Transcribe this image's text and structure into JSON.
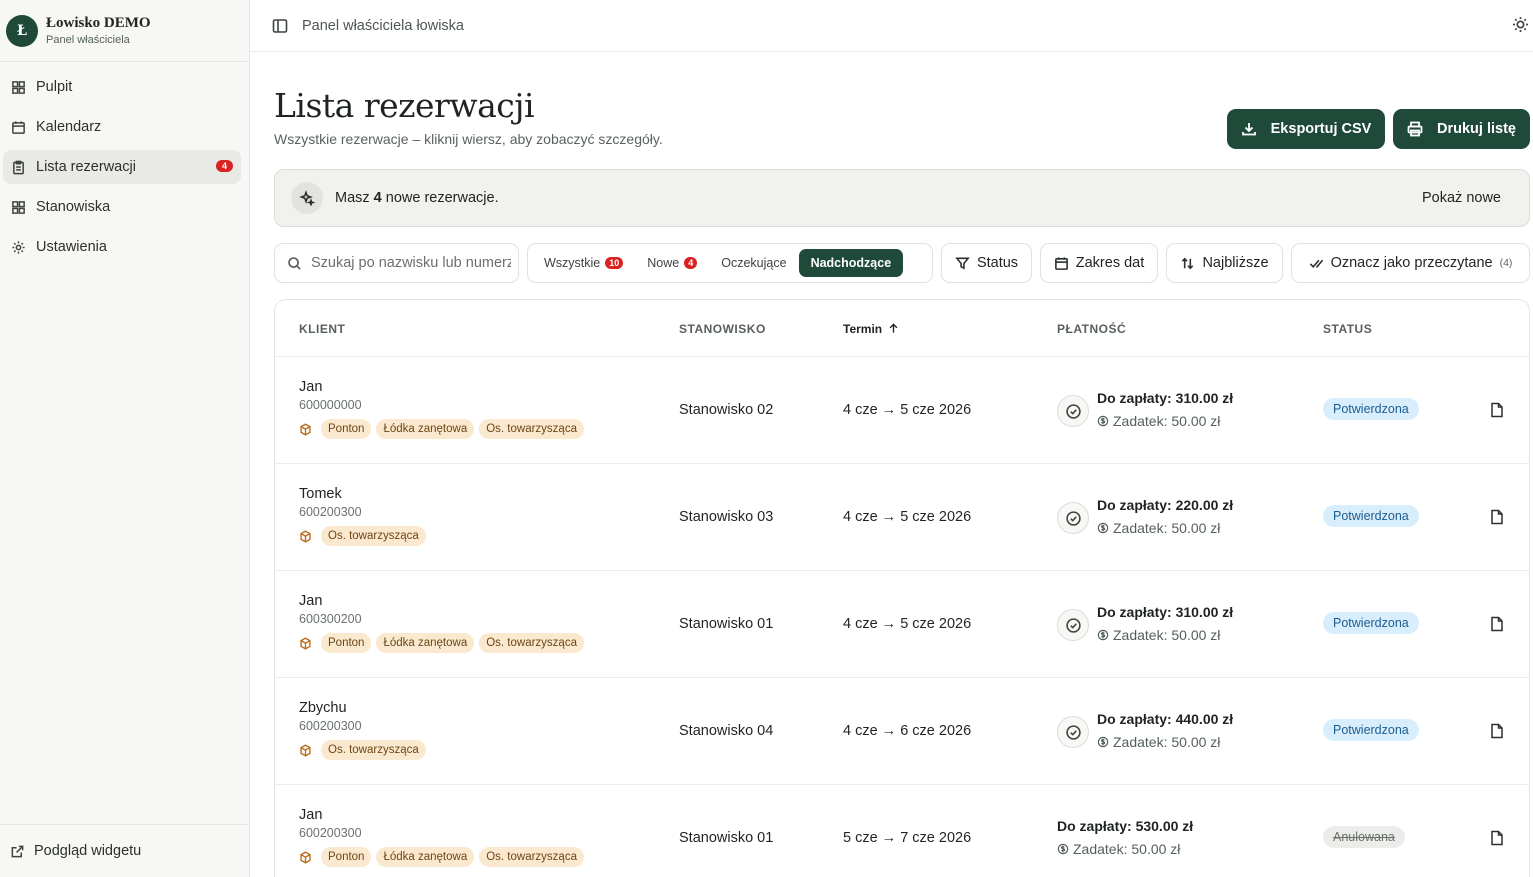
{
  "brand": {
    "logo_letter": "Ł",
    "title": "Łowisko DEMO",
    "subtitle": "Panel właściciela"
  },
  "nav": [
    {
      "label": "Pulpit",
      "icon": "dashboard-icon"
    },
    {
      "label": "Kalendarz",
      "icon": "calendar-icon"
    },
    {
      "label": "Lista rezerwacji",
      "icon": "clipboard-icon",
      "badge": "4",
      "active": true
    },
    {
      "label": "Stanowiska",
      "icon": "grid-icon"
    },
    {
      "label": "Ustawienia",
      "icon": "gear-icon"
    }
  ],
  "footer_link": "Podgląd widgetu",
  "topbar": {
    "title": "Panel właściciela łowiska"
  },
  "page": {
    "title": "Lista rezerwacji",
    "subtitle": "Wszystkie rezerwacje – kliknij wiersz, aby zobaczyć szczegóły.",
    "export_label": "Eksportuj CSV",
    "print_label": "Drukuj listę"
  },
  "notice": {
    "prefix": "Masz ",
    "count": "4",
    "suffix": " nowe rezerwacje.",
    "action": "Pokaż nowe"
  },
  "filters": {
    "search_placeholder": "Szukaj po nazwisku lub numerze",
    "segments": [
      {
        "label": "Wszystkie",
        "count": "10"
      },
      {
        "label": "Nowe",
        "count": "4"
      },
      {
        "label": "Oczekujące"
      },
      {
        "label": "Nadchodzące",
        "active": true
      }
    ],
    "status_label": "Status",
    "range_label": "Zakres dat",
    "sort_label": "Najbliższe",
    "mark_read_label": "Oznacz jako przeczytane",
    "mark_read_count": "(4)"
  },
  "table": {
    "headers": {
      "client": "KLIENT",
      "spot": "STANOWISKO",
      "term": "Termin",
      "payment": "PŁATNOŚĆ",
      "status": "STATUS"
    },
    "rows": [
      {
        "name": "Jan",
        "phone": "600000000",
        "tags": [
          "Ponton",
          "Łódka zanętowa",
          "Os. towarzysząca"
        ],
        "spot": "Stanowisko 02",
        "term": "4 cze → 5 cze 2026",
        "due": "Do zapłaty: 310.00 zł",
        "deposit": "Zadatek: 50.00 zł",
        "status": "Potwierdzona",
        "status_type": "ok"
      },
      {
        "name": "Tomek",
        "phone": "600200300",
        "tags": [
          "Os. towarzysząca"
        ],
        "spot": "Stanowisko 03",
        "term": "4 cze → 5 cze 2026",
        "due": "Do zapłaty: 220.00 zł",
        "deposit": "Zadatek: 50.00 zł",
        "status": "Potwierdzona",
        "status_type": "ok"
      },
      {
        "name": "Jan",
        "phone": "600300200",
        "tags": [
          "Ponton",
          "Łódka zanętowa",
          "Os. towarzysząca"
        ],
        "spot": "Stanowisko 01",
        "term": "4 cze → 5 cze 2026",
        "due": "Do zapłaty: 310.00 zł",
        "deposit": "Zadatek: 50.00 zł",
        "status": "Potwierdzona",
        "status_type": "ok"
      },
      {
        "name": "Zbychu",
        "phone": "600200300",
        "tags": [
          "Os. towarzysząca"
        ],
        "spot": "Stanowisko 04",
        "term": "4 cze → 6 cze 2026",
        "due": "Do zapłaty: 440.00 zł",
        "deposit": "Zadatek: 50.00 zł",
        "status": "Potwierdzona",
        "status_type": "ok"
      },
      {
        "name": "Jan",
        "phone": "600200300",
        "tags": [
          "Ponton",
          "Łódka zanętowa",
          "Os. towarzysząca"
        ],
        "spot": "Stanowisko 01",
        "term": "5 cze → 7 cze 2026",
        "due": "Do zapłaty: 530.00 zł",
        "deposit": "Zadatek: 50.00 zł",
        "status": "Anulowana",
        "status_type": "cancel"
      }
    ]
  },
  "colors": {
    "primary": "#1f4a3a",
    "badge_red": "#d92323",
    "tag_bg": "#fbe9cf",
    "status_ok_bg": "#d9eefc"
  }
}
